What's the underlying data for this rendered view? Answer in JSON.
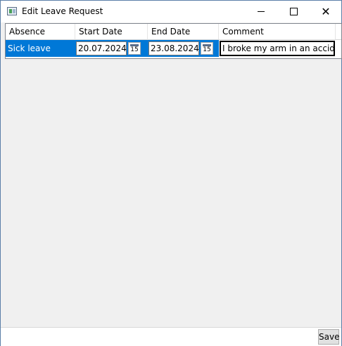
{
  "window": {
    "title": "Edit Leave Request"
  },
  "grid": {
    "columns": [
      "Absence Reason",
      "Start Date",
      "End Date",
      "Comment"
    ],
    "rows": [
      {
        "absence_reason": "Sick leave",
        "start_date": "20.07.2024",
        "end_date": "23.08.2024",
        "comment": "I broke my arm in an accident"
      }
    ],
    "calendar_icon_label": "15"
  },
  "footer": {
    "save_label": "Save"
  },
  "colors": {
    "selection": "#0078d7",
    "window_border": "#5b7fa8"
  },
  "icons": {
    "app": "app-window-icon",
    "calendar": "calendar-icon"
  }
}
